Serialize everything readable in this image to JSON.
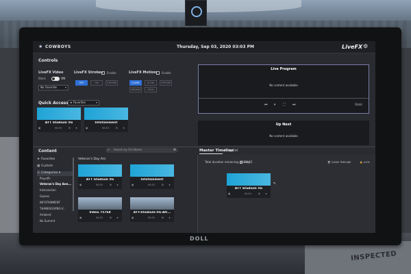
{
  "monitor": {
    "brand": "DOLL"
  },
  "environment": {
    "box_label": "INSPECTED"
  },
  "topbar": {
    "brand": "COWBOYS",
    "datetime": "Thursday, Sep 03, 2020  03:03 PM",
    "app_name": "LiveFX"
  },
  "controls": {
    "title": "Controls",
    "video": {
      "title": "LiveFX Video",
      "black_label": "Black",
      "toggle_label": "ON",
      "select_value": "No Override"
    },
    "strobes": {
      "title": "LiveFX Strobes",
      "enable_label": "Enable",
      "buttons": [
        "OFF",
        "ON",
        "STROBE"
      ]
    },
    "motion": {
      "title": "LiveFX Motion",
      "enable_label": "Enable",
      "buttons": [
        "CLOSE",
        "SLOW",
        "STROBE",
        "MEDIUM",
        "HIGH"
      ]
    }
  },
  "live_program": {
    "title": "Live Program",
    "empty_text": "No content available",
    "status": "Static"
  },
  "up_next": {
    "title": "Up Next",
    "empty_text": "No content available"
  },
  "quick_access": {
    "title": "Quick Access",
    "filter": "Favorites",
    "tiles": [
      {
        "label": "ATT Stadium 5G",
        "time": "00:15"
      },
      {
        "label": "Infotainment",
        "time": "00:15"
      }
    ]
  },
  "content": {
    "title": "Content",
    "search_placeholder": "Search by File Name",
    "sidebar": {
      "favorites": "Favorites",
      "custom": "Custom",
      "categories": "Categories",
      "subitems": [
        "Playoffs",
        "Veteran's Day Ann...",
        "Intersection",
        "Games",
        "INFOTAINMENT",
        "THANKSGIVING-V...",
        "Ambient",
        "No Summit"
      ]
    },
    "folder_title": "Veteran's Day Ani",
    "items": [
      {
        "label": "ATT Stadium 5G",
        "time": "00:15"
      },
      {
        "label": "Infotainment",
        "time": "00:15"
      },
      {
        "label": "Video 75768",
        "time": "00:15"
      },
      {
        "label": "ATT-Stadium-5G-Alt...",
        "time": "00:15"
      }
    ]
  },
  "timeline": {
    "title": "Master Timeline",
    "playlist_tab": "Playlist",
    "remaining": "Total duration remaining: 00:00:15",
    "loop_label": "Loop",
    "clear_label": "CLEAR TIMELINE",
    "lock_label": "LOCK",
    "item": {
      "label": "ATT Stadium 5G",
      "time": "00:15"
    }
  }
}
